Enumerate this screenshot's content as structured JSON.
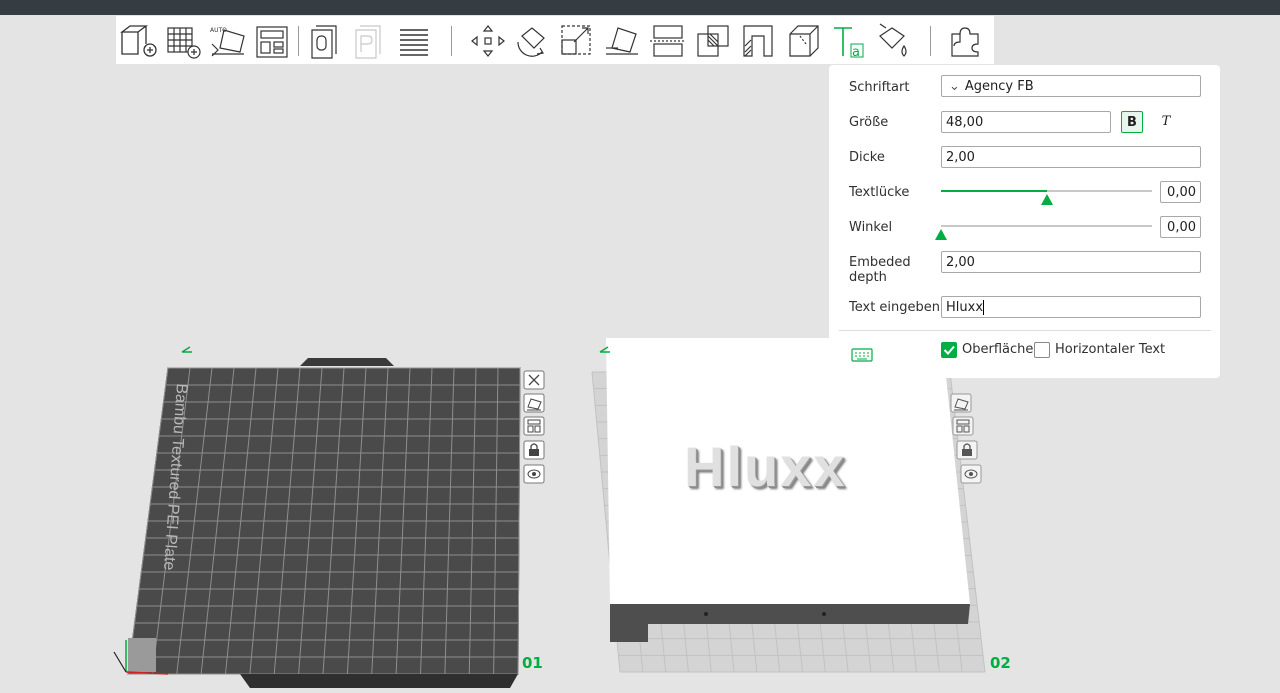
{
  "toolbar": {
    "icons": [
      "add-cube-icon",
      "add-plate-icon",
      "auto-orient-icon",
      "arrange-icon",
      "plate-objects-icon",
      "plate-p-icon",
      "layers-icon",
      "move-icon",
      "rotate-icon",
      "scale-icon",
      "lay-on-face-icon",
      "cut-icon",
      "boolean-icon",
      "support-paint-icon",
      "measure-icon",
      "text-tool-icon",
      "color-paint-icon",
      "assembly-icon"
    ]
  },
  "text_panel": {
    "font_label": "Schriftart",
    "font_value": "Agency FB",
    "font_chevron": "⌄",
    "size_label": "Größe",
    "size_value": "48,00",
    "bold_label": "B",
    "italic_label": "T",
    "thickness_label": "Dicke",
    "thickness_value": "2,00",
    "text_gap_label": "Textlücke",
    "text_gap_value": "0,00",
    "text_gap_fraction": 0.5,
    "angle_label": "Winkel",
    "angle_value": "0,00",
    "angle_fraction": 0.0,
    "embed_label_1": "Embeded",
    "embed_label_2": "depth",
    "embed_value": "2,00",
    "input_label": "Text eingeben",
    "input_value": "Hluxx",
    "surface_label": "Oberfläche",
    "surface_checked": true,
    "horizontal_label": "Horizontaler Text",
    "horizontal_checked": false
  },
  "plates": {
    "plate1_number": "01",
    "plate1_texture_text": "Bambu Textured PEI Plate",
    "plate2_number": "02",
    "plate2_model_text": "Hluxx"
  },
  "colors": {
    "accent": "#00ae42",
    "topbar": "#363d42",
    "background": "#e4e4e4"
  }
}
